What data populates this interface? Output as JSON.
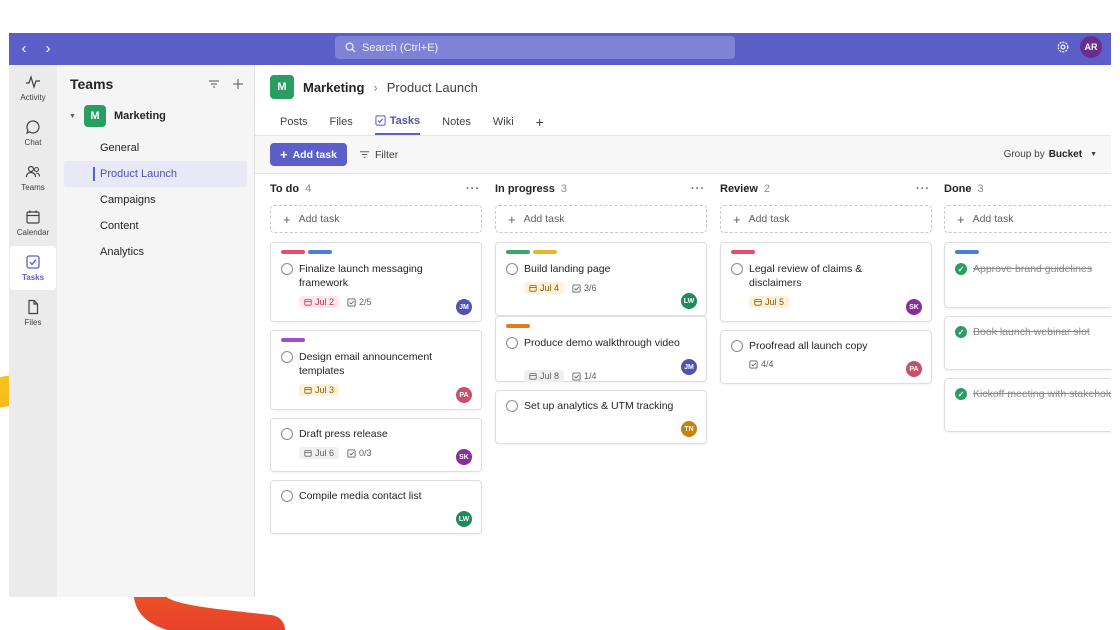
{
  "colors": {
    "accent": "#5b5fc7",
    "brand_green": "#2a9d62",
    "squiggle_yellow": "#f7c21a",
    "squiggle_orange": "#f07c1e",
    "squiggle_red": "#e8412a"
  },
  "titlebar": {
    "back_icon": "chevron-left-icon",
    "forward_icon": "chevron-right-icon",
    "search_placeholder": "Search (Ctrl+E)",
    "settings_icon": "gear-icon",
    "user_initials": "AR"
  },
  "rail": {
    "items": [
      {
        "label": "Activity",
        "icon": "activity-icon"
      },
      {
        "label": "Chat",
        "icon": "chat-icon"
      },
      {
        "label": "Teams",
        "icon": "teams-icon"
      },
      {
        "label": "Calendar",
        "icon": "calendar-icon"
      },
      {
        "label": "Tasks",
        "icon": "tasks-icon",
        "active": true
      },
      {
        "label": "Files",
        "icon": "file-icon"
      }
    ]
  },
  "teams_panel": {
    "title": "Teams",
    "team": {
      "badge": "M",
      "name": "Marketing"
    },
    "channels": [
      "General",
      "Product Launch",
      "Campaigns",
      "Content",
      "Analytics"
    ],
    "active_channel": "Product Launch"
  },
  "header": {
    "team_badge": "M",
    "team_name": "Marketing",
    "separator": "›",
    "channel_name": "Product Launch",
    "tabs": [
      "Posts",
      "Files",
      "Tasks",
      "Notes",
      "Wiki",
      "+"
    ],
    "active_tab": "Tasks"
  },
  "toolbar": {
    "add_task_label": "Add task",
    "filter_label": "Filter",
    "group_by_label": "Group by",
    "group_by_value": "Bucket"
  },
  "board": {
    "add_task_label": "Add task",
    "columns": [
      {
        "name": "To do",
        "count": "4",
        "cards": [
          {
            "title": "Finalize launch messaging framework",
            "labels": [
              "#e84c6d",
              "#4a7fd6"
            ],
            "date": "Jul 2",
            "date_style": "red",
            "checklist": "2/5",
            "assignee": "JM",
            "assignee_color": "#4f52b2",
            "done": false
          },
          {
            "title": "Design email announcement templates",
            "labels": [
              "#9b4dd6"
            ],
            "date": "Jul 3",
            "date_style": "amber",
            "checklist": "",
            "assignee": "PA",
            "assignee_color": "#c94f6d",
            "done": false
          },
          {
            "title": "Draft press release",
            "labels": [],
            "date": "Jul 6",
            "date_style": "grey",
            "checklist": "0/3",
            "assignee": "SK",
            "assignee_color": "#8a2c9e",
            "done": false
          },
          {
            "title": "Compile media contact list",
            "labels": [],
            "date": "",
            "date_style": "",
            "checklist": "",
            "assignee": "LW",
            "assignee_color": "#1f8a5b",
            "done": false
          }
        ]
      },
      {
        "name": "In progress",
        "count": "3",
        "cards": [
          {
            "title": "Build landing page",
            "labels": [
              "#3aa865",
              "#e8b52a"
            ],
            "date": "Jul 4",
            "date_style": "amber",
            "checklist": "3/6",
            "assignee": "LW",
            "assignee_color": "#1f8a5b",
            "done": false
          },
          {
            "title": "Produce demo walkthrough video",
            "labels": [
              "#e07b1f"
            ],
            "date": "Jul 8",
            "date_style": "grey",
            "checklist": "1/4",
            "assignee": "JM",
            "assignee_color": "#4f52b2",
            "done": false
          },
          {
            "title": "Set up analytics & UTM tracking",
            "labels": [],
            "date": "",
            "date_style": "",
            "checklist": "",
            "assignee": "TN",
            "assignee_color": "#c9820f",
            "done": false
          }
        ]
      },
      {
        "name": "Review",
        "count": "2",
        "cards": [
          {
            "title": "Legal review of claims & disclaimers",
            "labels": [
              "#e84c6d"
            ],
            "date": "Jul 5",
            "date_style": "amber",
            "checklist": "",
            "assignee": "SK",
            "assignee_color": "#8a2c9e",
            "done": false
          },
          {
            "title": "Proofread all launch copy",
            "labels": [],
            "date": "",
            "date_style": "",
            "checklist": "4/4",
            "assignee": "PA",
            "assignee_color": "#c94f6d",
            "done": false
          }
        ]
      },
      {
        "name": "Done",
        "count": "3",
        "cards": [
          {
            "title": "Approve brand guidelines",
            "labels": [
              "#4a7fd6"
            ],
            "date": "",
            "date_style": "",
            "checklist": "",
            "assignee": "",
            "assignee_color": "",
            "done": true
          },
          {
            "title": "Book launch webinar slot",
            "labels": [],
            "date": "",
            "date_style": "",
            "checklist": "",
            "assignee": "",
            "assignee_color": "",
            "done": true
          },
          {
            "title": "Kickoff meeting with stakeholders",
            "labels": [],
            "date": "",
            "date_style": "",
            "checklist": "",
            "assignee": "",
            "assignee_color": "",
            "done": true
          }
        ]
      }
    ]
  }
}
